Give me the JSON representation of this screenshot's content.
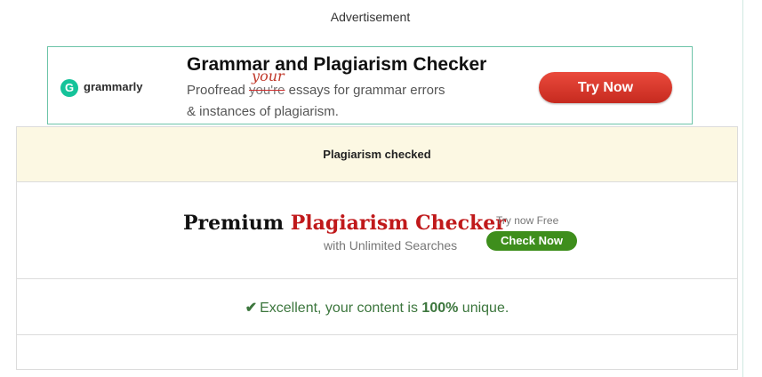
{
  "advertisement_label": "Advertisement",
  "ad": {
    "logo_letter": "G",
    "brand": "grammarly",
    "title": "Grammar and Plagiarism Checker",
    "line1_prefix": "Proofread ",
    "line1_struck": "you're",
    "line1_correction": "your",
    "line1_suffix": " essays for grammar errors",
    "line2": "& instances of plagiarism.",
    "button": "Try Now",
    "accent_color": "#15c39a",
    "button_color": "#d93a2e"
  },
  "result_panel": {
    "header": "Plagiarism checked",
    "premium": {
      "title_black": "Premium",
      "title_red": "Plagiarism Checker",
      "subtitle": "with Unlimited Searches",
      "try_free": "Try now Free",
      "button": "Check Now"
    },
    "result": {
      "icon": "checkmark-icon",
      "prefix": "Excellent, your content is ",
      "percent": "100%",
      "suffix": " unique."
    }
  }
}
